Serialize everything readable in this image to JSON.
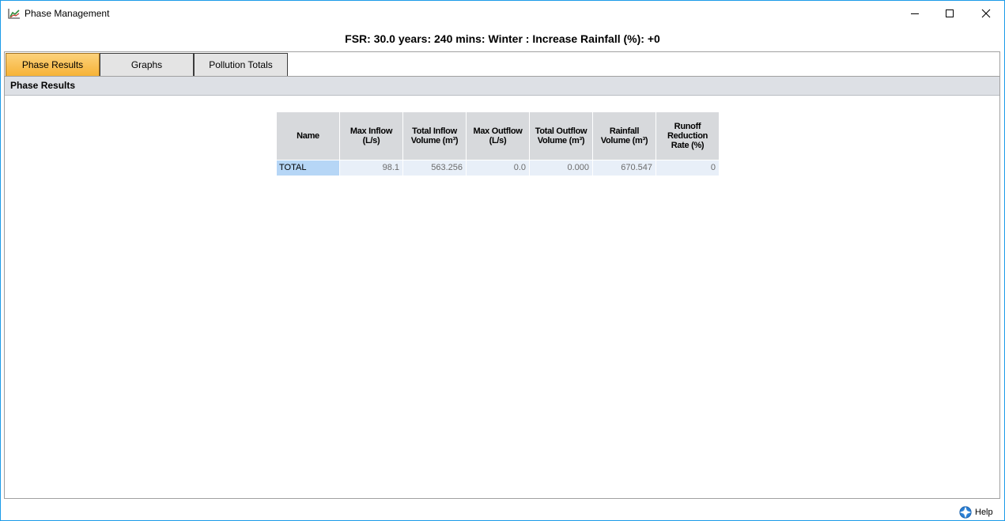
{
  "window": {
    "title": "Phase Management"
  },
  "subtitle": "FSR: 30.0 years: 240 mins: Winter : Increase Rainfall (%): +0",
  "tabs": [
    {
      "label": "Phase Results",
      "active": true
    },
    {
      "label": "Graphs",
      "active": false
    },
    {
      "label": "Pollution Totals",
      "active": false
    }
  ],
  "panel": {
    "title": "Phase Results"
  },
  "table": {
    "headers": [
      [
        "Name"
      ],
      [
        "Max Inflow",
        "(L/s)"
      ],
      [
        "Total Inflow",
        "Volume (m³)"
      ],
      [
        "Max Outflow",
        "(L/s)"
      ],
      [
        "Total Outflow",
        "Volume (m³)"
      ],
      [
        "Rainfall",
        "Volume (m³)"
      ],
      [
        "Runoff",
        "Reduction",
        "Rate (%)"
      ]
    ],
    "rows": [
      [
        "TOTAL",
        "98.1",
        "563.256",
        "0.0",
        "0.000",
        "670.547",
        "0"
      ]
    ]
  },
  "footer": {
    "help_label": "Help"
  },
  "colors": {
    "accent": "#1c9be8",
    "active_tab": "#f6b134",
    "selected_cell": "#b6d6f6"
  },
  "icons": [
    "app-chart-icon",
    "minimize-icon",
    "maximize-icon",
    "close-icon",
    "help-icon"
  ]
}
